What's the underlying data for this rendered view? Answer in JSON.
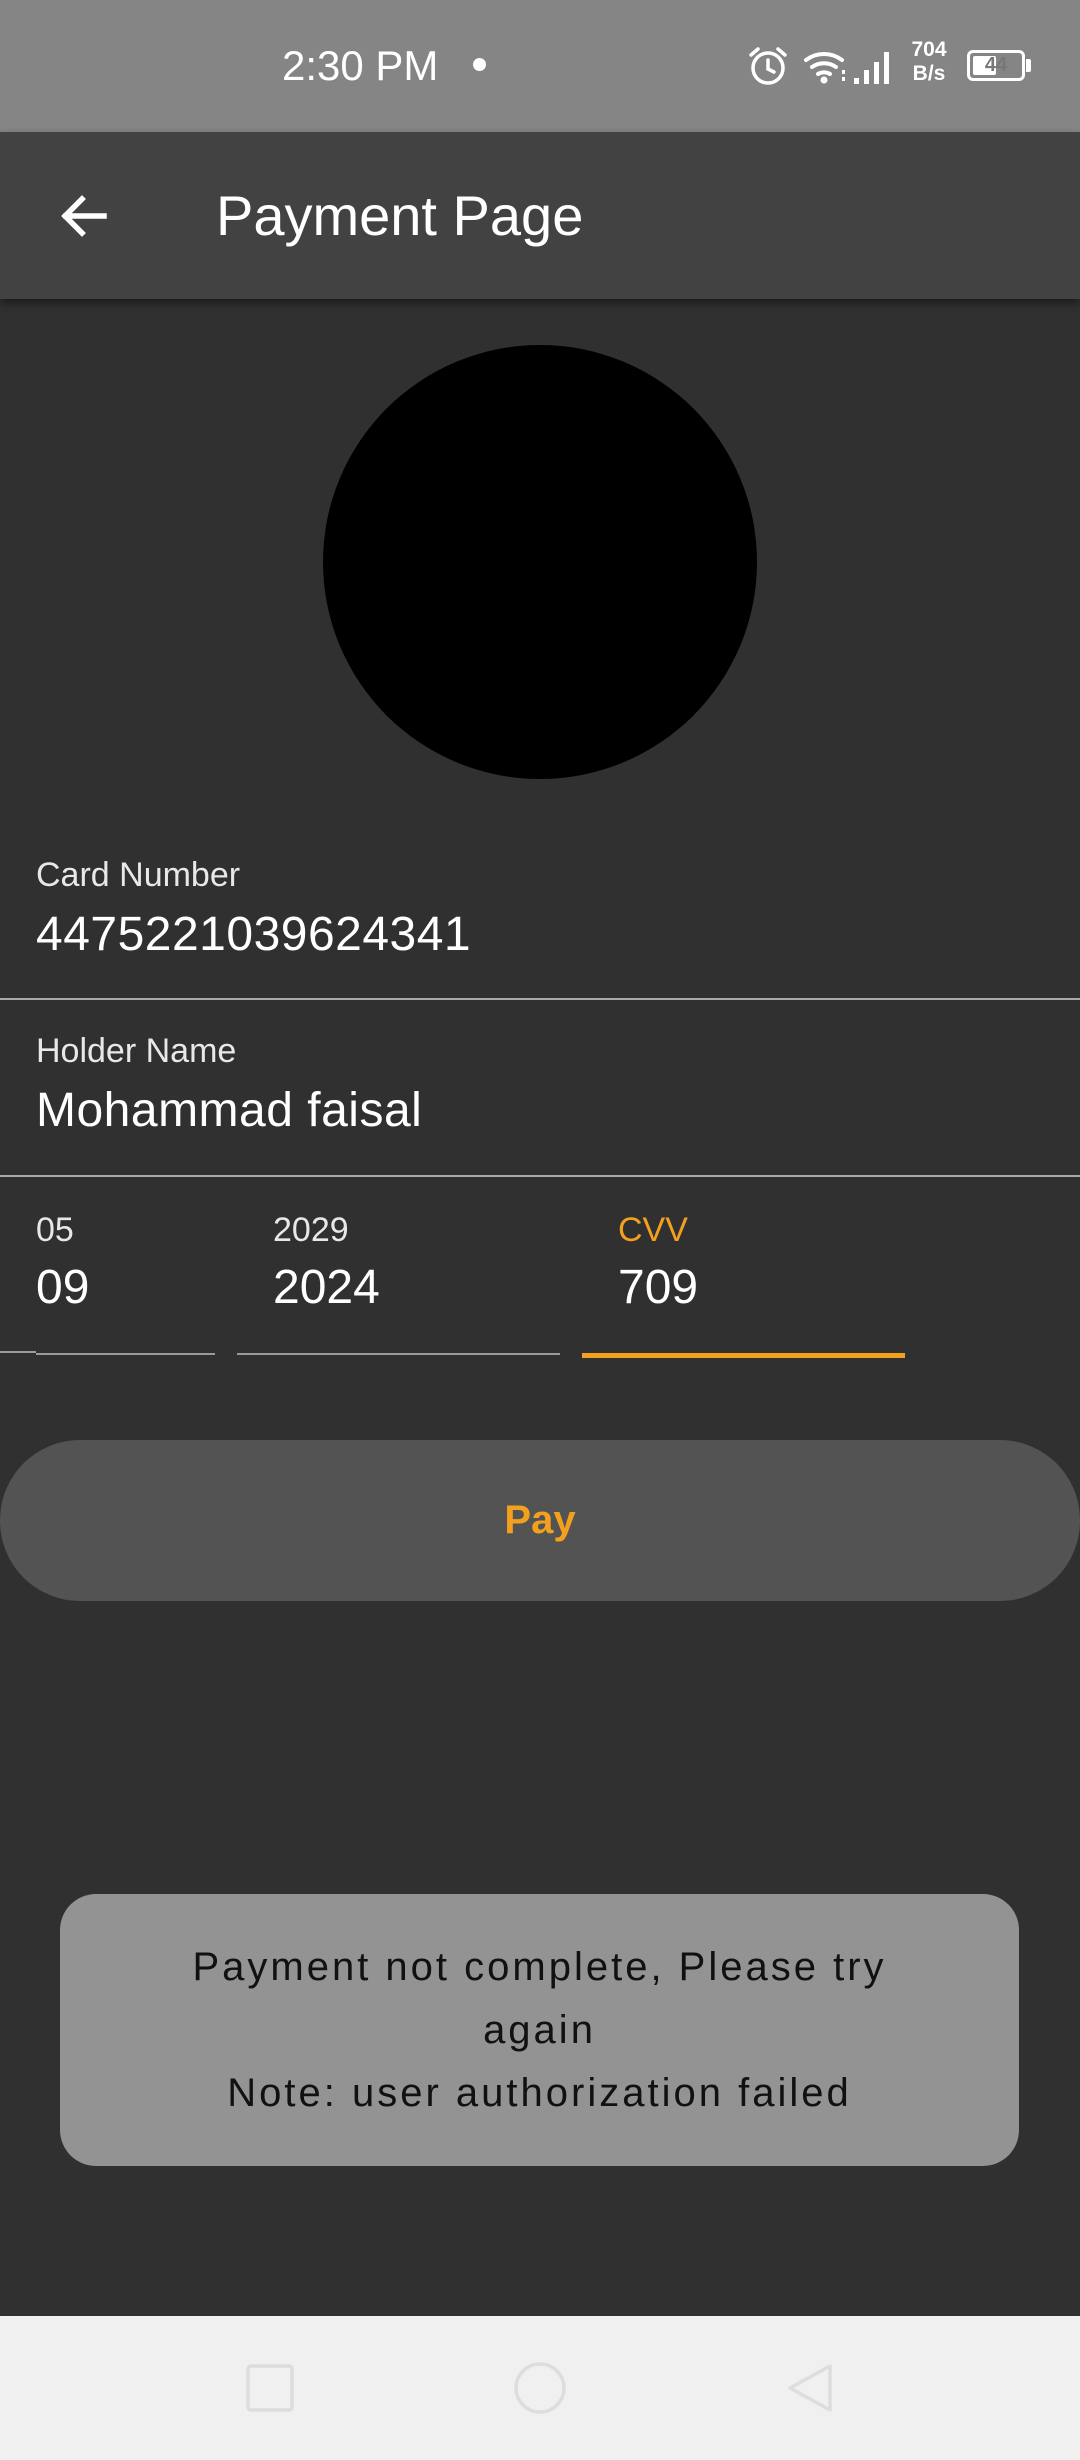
{
  "status_bar": {
    "time": "2:30 PM",
    "net_speed_value": "704",
    "net_speed_unit": "B/s",
    "battery_level": "44",
    "icons": [
      "alarm-icon",
      "wifi-icon",
      "signal-icon",
      "battery-icon"
    ]
  },
  "app_bar": {
    "title": "Payment Page",
    "back_icon": "arrow-left-icon"
  },
  "form": {
    "card_number": {
      "label": "Card Number",
      "value": "4475221039624341"
    },
    "holder_name": {
      "label": "Holder Name",
      "value": "Mohammad faisal"
    },
    "expiry_month": {
      "label": "05",
      "value": "09"
    },
    "expiry_year": {
      "label": "2029",
      "value": "2024"
    },
    "cvv": {
      "label": "CVV",
      "value": "709"
    }
  },
  "pay_button": {
    "label": "Pay"
  },
  "toast": {
    "line1": "Payment not complete, Please try",
    "line2": "again",
    "line3": "Note: user authorization failed"
  },
  "nav_bar": {
    "icons": [
      "recents-icon",
      "home-icon",
      "back-icon"
    ]
  },
  "colors": {
    "accent": "#f2a01e",
    "background": "#303030",
    "app_bar": "#424242",
    "status_bar": "#858585",
    "toast": "#939393",
    "button": "#535353"
  }
}
